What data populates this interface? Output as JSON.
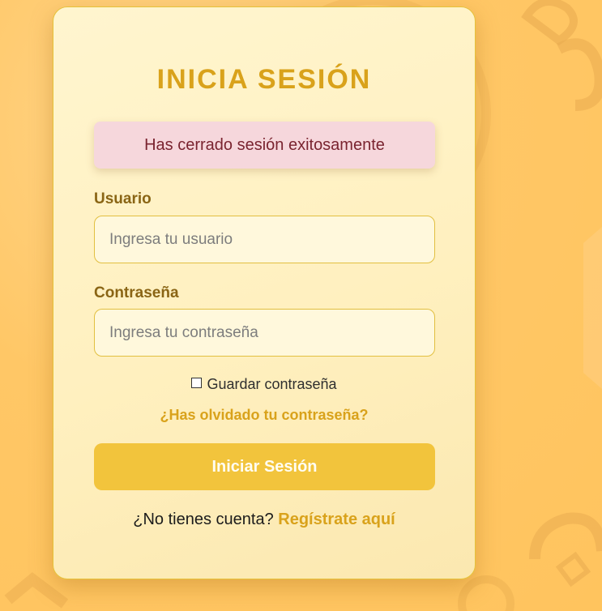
{
  "login": {
    "title": "INICIA SESIÓN",
    "alert_message": "Has cerrado sesión exitosamente",
    "username_label": "Usuario",
    "username_placeholder": "Ingresa tu usuario",
    "password_label": "Contraseña",
    "password_placeholder": "Ingresa tu contraseña",
    "remember_label": "Guardar contraseña",
    "remember_checked": false,
    "forgot_link": "¿Has olvidado tu contraseña?",
    "submit_label": "Iniciar Sesión",
    "register_prompt": "¿No tienes cuenta?",
    "register_link": "Regístrate aquí"
  },
  "colors": {
    "accent": "#d9a21b",
    "button": "#f2c43c",
    "background": "#ffc766",
    "alert_bg": "#f6d7dc",
    "alert_text": "#7a2430"
  }
}
